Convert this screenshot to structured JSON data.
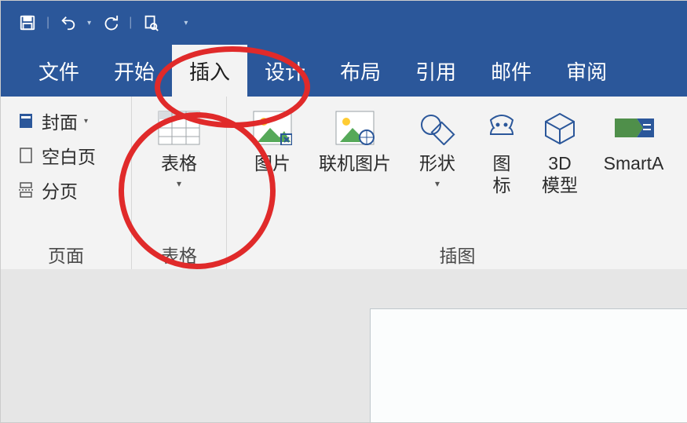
{
  "qat": {
    "save_tip": "保存",
    "undo_tip": "撤销",
    "redo_tip": "重做",
    "preview_tip": "打印预览"
  },
  "tabs": [
    {
      "id": "file",
      "label": "文件"
    },
    {
      "id": "home",
      "label": "开始"
    },
    {
      "id": "insert",
      "label": "插入",
      "active": true
    },
    {
      "id": "design",
      "label": "设计"
    },
    {
      "id": "layout",
      "label": "布局"
    },
    {
      "id": "references",
      "label": "引用"
    },
    {
      "id": "mailings",
      "label": "邮件"
    },
    {
      "id": "review",
      "label": "审阅"
    }
  ],
  "ribbon": {
    "pages_group": {
      "label": "页面",
      "cover": "封面",
      "blank": "空白页",
      "break": "分页"
    },
    "tables_group": {
      "label": "表格",
      "table": "表格"
    },
    "illustrations_group": {
      "label": "插图",
      "picture": "图片",
      "online_pic": "联机图片",
      "shapes": "形状",
      "icons_line1": "图",
      "icons_line2": "标",
      "model_line1": "3D",
      "model_line2": "模型",
      "smartart": "SmartA"
    }
  },
  "annotation": {
    "circle1_target": "insert-tab",
    "circle2_target": "table-button"
  }
}
